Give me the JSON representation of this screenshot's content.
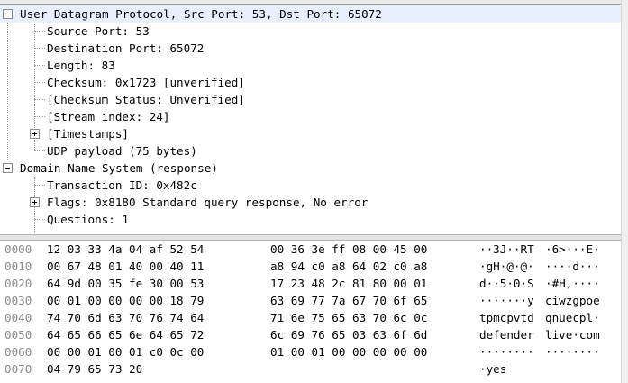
{
  "tree": {
    "rows": [
      {
        "text": "User Datagram Protocol, Src Port: 53, Dst Port: 65072"
      },
      {
        "text": "Source Port: 53"
      },
      {
        "text": "Destination Port: 65072"
      },
      {
        "text": "Length: 83"
      },
      {
        "text": "Checksum: 0x1723 [unverified]"
      },
      {
        "text": "[Checksum Status: Unverified]"
      },
      {
        "text": "[Stream index: 24]"
      },
      {
        "text": "[Timestamps]"
      },
      {
        "text": "UDP payload (75 bytes)"
      },
      {
        "text": "Domain Name System (response)"
      },
      {
        "text": "Transaction ID: 0x482c"
      },
      {
        "text": "Flags: 0x8180 Standard query response, No error"
      },
      {
        "text": "Questions: 1"
      }
    ]
  },
  "bytes": {
    "rows": [
      {
        "offset": "0000",
        "hex1": "12 03 33 4a 04 af 52 54",
        "hex2": "00 36 3e ff 08 00 45 00",
        "asc1": "··3J··RT",
        "asc2": "·6>···E·"
      },
      {
        "offset": "0010",
        "hex1": "00 67 48 01 40 00 40 11",
        "hex2": "a8 94 c0 a8 64 02 c0 a8",
        "asc1": "·gH·@·@·",
        "asc2": "····d···"
      },
      {
        "offset": "0020",
        "hex1": "64 9d 00 35 fe 30 00 53",
        "hex2": "17 23 48 2c 81 80 00 01",
        "asc1": "d··5·0·S",
        "asc2": "·#H,····"
      },
      {
        "offset": "0030",
        "hex1": "00 01 00 00 00 00 18 79",
        "hex2": "63 69 77 7a 67 70 6f 65",
        "asc1": "·······y",
        "asc2": "ciwzgpoe"
      },
      {
        "offset": "0040",
        "hex1": "74 70 6d 63 70 76 74 64",
        "hex2": "71 6e 75 65 63 70 6c 0c",
        "asc1": "tpmcpvtd",
        "asc2": "qnuecpl·"
      },
      {
        "offset": "0050",
        "hex1": "64 65 66 65 6e 64 65 72",
        "hex2": "6c 69 76 65 03 63 6f 6d",
        "asc1": "defender",
        "asc2": "live·com"
      },
      {
        "offset": "0060",
        "hex1": "00 00 01 00 01 c0 0c 00",
        "hex2": "01 00 01 00 00 00 00 00",
        "asc1": "········",
        "asc2": "········"
      },
      {
        "offset": "0070",
        "hex1": "04 79 65 73 20",
        "hex2": "",
        "asc1": "·yes",
        "asc2": ""
      }
    ]
  }
}
